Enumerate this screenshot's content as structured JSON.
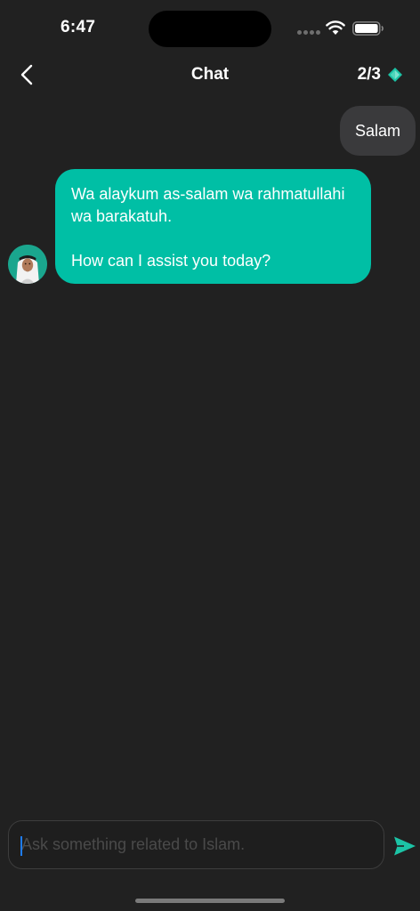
{
  "status_bar": {
    "time": "6:47"
  },
  "nav": {
    "title": "Chat",
    "credits": "2/3",
    "icons": {
      "back": "chevron-left-icon",
      "credits": "gem-icon"
    }
  },
  "messages": [
    {
      "role": "user",
      "text": "Salam"
    },
    {
      "role": "assistant",
      "paragraphs": [
        "Wa alaykum as-salam wa rahmatullahi wa barakatuh.",
        "How can I assist you today?"
      ]
    }
  ],
  "composer": {
    "value": "",
    "placeholder": "Ask something related to Islam."
  },
  "colors": {
    "background": "#212121",
    "user_bubble": "#3a3a3c",
    "assistant_bubble": "#00bfa5",
    "accent": "#1cc4a6",
    "caret": "#1e7cf5"
  }
}
